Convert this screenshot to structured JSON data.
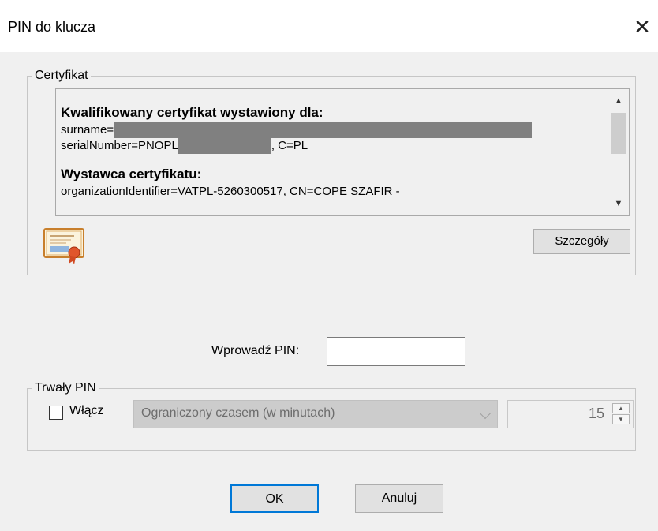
{
  "window": {
    "title": "PIN do klucza"
  },
  "certificate": {
    "legend": "Certyfikat",
    "issued_heading": "Kwalifikowany certyfikat wystawiony dla:",
    "surname_label": "surname=",
    "serial_label": "serialNumber=PNOPL",
    "serial_suffix": ", C=PL",
    "issuer_heading": "Wystawca certyfikatu:",
    "issuer_line": "organizationIdentifier=VATPL-5260300517, CN=COPE SZAFIR -",
    "details_button": "Szczegóły"
  },
  "pin": {
    "label": "Wprowadź PIN:",
    "value": "",
    "placeholder": ""
  },
  "persistent_pin": {
    "legend": "Trwały PIN",
    "enable_label": "Włącz",
    "enabled": false,
    "mode_selected": "Ograniczony czasem (w minutach)",
    "minutes": "15"
  },
  "buttons": {
    "ok": "OK",
    "cancel": "Anuluj"
  },
  "colors": {
    "accent": "#0078d7",
    "redaction": "#808080",
    "window_bg": "#f0f0f0"
  }
}
